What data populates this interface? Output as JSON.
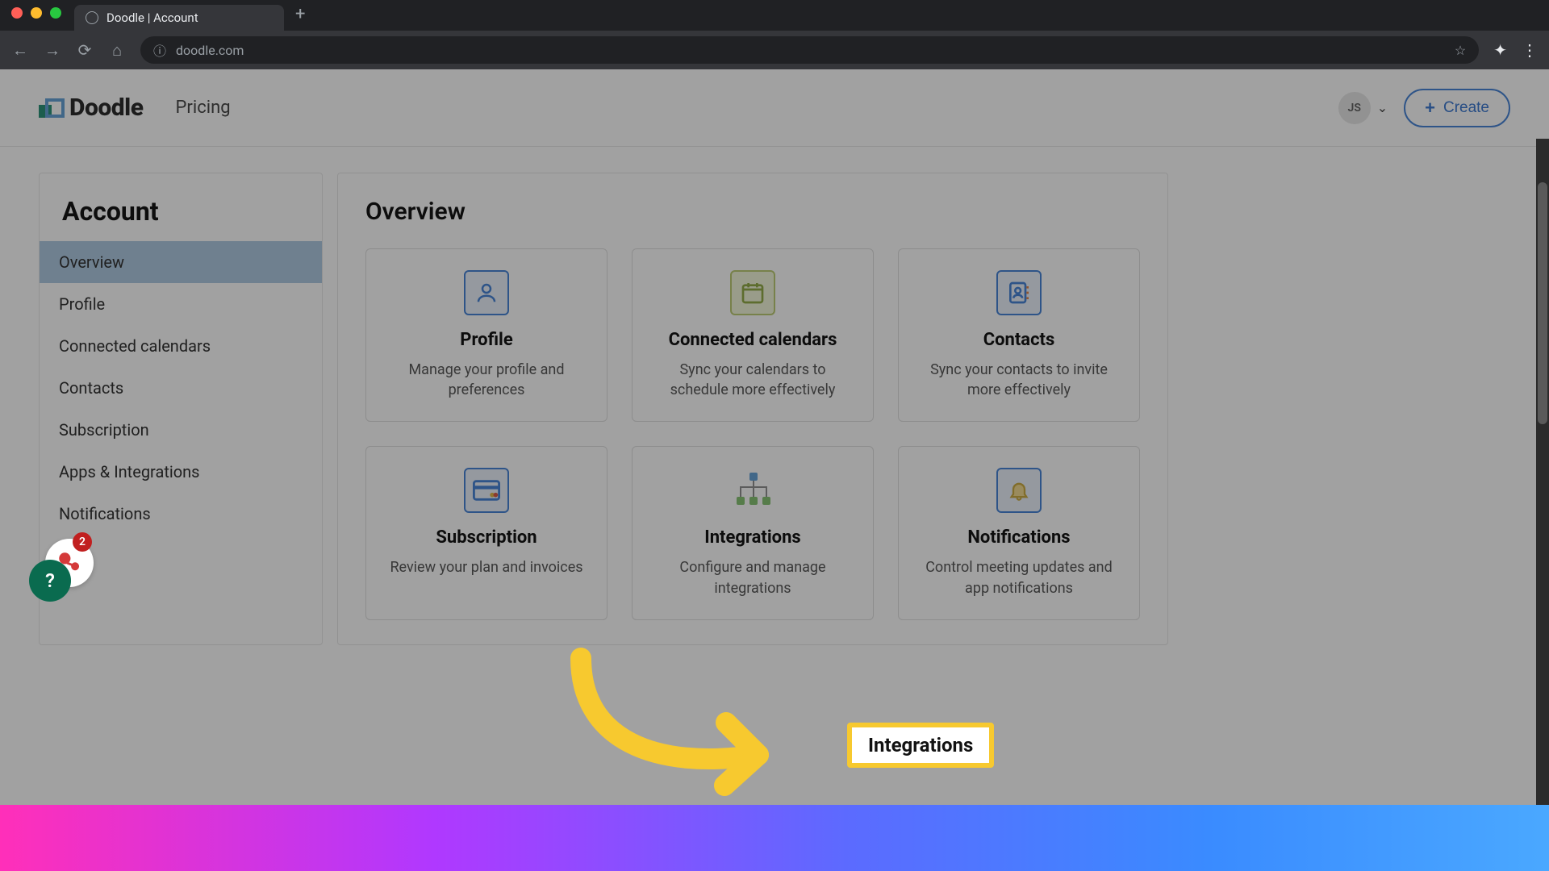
{
  "browser": {
    "tab_title": "Doodle | Account",
    "url": "doodle.com"
  },
  "header": {
    "brand": "Doodle",
    "pricing": "Pricing",
    "user_initials": "JS",
    "create": "Create"
  },
  "sidebar": {
    "title": "Account",
    "items": [
      {
        "label": "Overview",
        "active": true
      },
      {
        "label": "Profile"
      },
      {
        "label": "Connected calendars"
      },
      {
        "label": "Contacts"
      },
      {
        "label": "Subscription"
      },
      {
        "label": "Apps & Integrations"
      },
      {
        "label": "Notifications"
      }
    ]
  },
  "main": {
    "title": "Overview",
    "cards": [
      {
        "title": "Profile",
        "desc": "Manage your profile and preferences",
        "icon": "profile"
      },
      {
        "title": "Connected calendars",
        "desc": "Sync your calendars to schedule more effectively",
        "icon": "calendar"
      },
      {
        "title": "Contacts",
        "desc": "Sync your contacts to invite more effectively",
        "icon": "contacts"
      },
      {
        "title": "Subscription",
        "desc": "Review your plan and invoices",
        "icon": "card"
      },
      {
        "title": "Integrations",
        "desc": "Configure and manage integrations",
        "icon": "integrations"
      },
      {
        "title": "Notifications",
        "desc": "Control meeting updates and app notifications",
        "icon": "bell"
      }
    ]
  },
  "help": {
    "badge": "2",
    "symbol": "?"
  },
  "highlight": {
    "label": "Integrations"
  }
}
